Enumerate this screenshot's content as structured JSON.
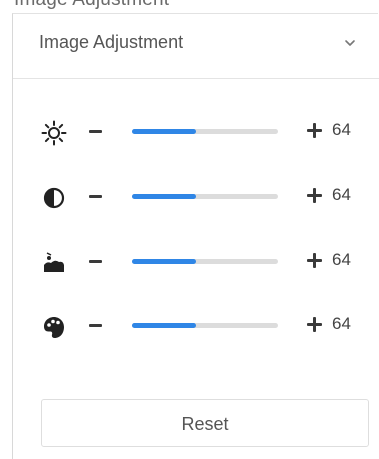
{
  "top_strip": {
    "text": "Image Adjustment"
  },
  "panel": {
    "title": "Image Adjustment",
    "chevron_icon": "chevron-down-icon",
    "sliders": [
      {
        "id": "brightness",
        "icon": "brightness-icon",
        "decrease_icon": "minus-icon",
        "increase_icon": "plus-icon",
        "value": "64",
        "level": 0.44
      },
      {
        "id": "contrast",
        "icon": "contrast-icon",
        "decrease_icon": "minus-icon",
        "increase_icon": "plus-icon",
        "value": "64",
        "level": 0.44
      },
      {
        "id": "saturation",
        "icon": "saturation-icon",
        "decrease_icon": "minus-icon",
        "increase_icon": "plus-icon",
        "value": "64",
        "level": 0.44
      },
      {
        "id": "hue",
        "icon": "hue-icon",
        "decrease_icon": "minus-icon",
        "increase_icon": "plus-icon",
        "value": "64",
        "level": 0.44
      }
    ],
    "reset_label": "Reset"
  },
  "colors": {
    "accent": "#2f86e6",
    "track": "#dcdcdc",
    "icon": "#222222"
  }
}
